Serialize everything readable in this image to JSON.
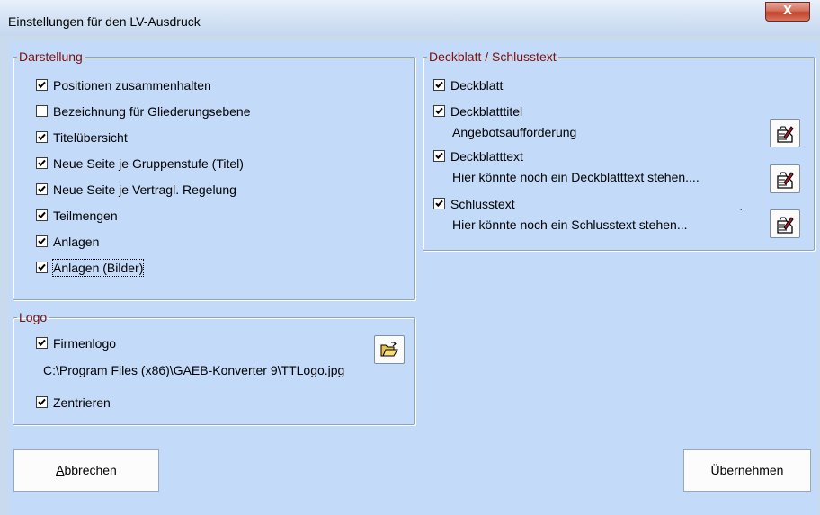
{
  "window": {
    "title": "Einstellungen für den LV-Ausdruck",
    "close_label": "X"
  },
  "darstellung": {
    "legend": "Darstellung",
    "items": [
      {
        "label": "Positionen zusammenhalten",
        "checked": true
      },
      {
        "label": "Bezeichnung für Gliederungsebene",
        "checked": false
      },
      {
        "label": "Titelübersicht",
        "checked": true
      },
      {
        "label": "Neue Seite je Gruppenstufe (Titel)",
        "checked": true
      },
      {
        "label": "Neue Seite je Vertragl. Regelung",
        "checked": true
      },
      {
        "label": "Teilmengen",
        "checked": true
      },
      {
        "label": "Anlagen",
        "checked": true
      },
      {
        "label": "Anlagen (Bilder)",
        "checked": true
      }
    ]
  },
  "logo": {
    "legend": "Logo",
    "firmenlogo": {
      "label": "Firmenlogo",
      "checked": true
    },
    "path": "C:\\Program Files (x86)\\GAEB-Konverter 9\\TTLogo.jpg",
    "zentrieren": {
      "label": "Zentrieren",
      "checked": true
    },
    "open_icon": "open-folder-icon"
  },
  "deckblatt": {
    "legend": "Deckblatt / Schlusstext",
    "deckblatt": {
      "label": "Deckblatt",
      "checked": true
    },
    "deckblatttitel": {
      "label": "Deckblatttitel",
      "checked": true,
      "value": "Angebotsaufforderung"
    },
    "deckblatttext": {
      "label": "Deckblatttext",
      "checked": true,
      "value": "Hier könnte noch ein Deckblatttext stehen...."
    },
    "schlusstext": {
      "label": "Schlusstext",
      "checked": true,
      "value": "Hier könnte noch ein Schlusstext stehen...",
      "mark": "´"
    },
    "edit_icon": "edit-note-icon"
  },
  "buttons": {
    "cancel_mnemonic": "A",
    "cancel_rest": "bbrechen",
    "ok": "Übernehmen"
  },
  "colors": {
    "client_bg": "#c3daf9",
    "legend_text": "#7a1010",
    "close_button": "#c1432b"
  }
}
